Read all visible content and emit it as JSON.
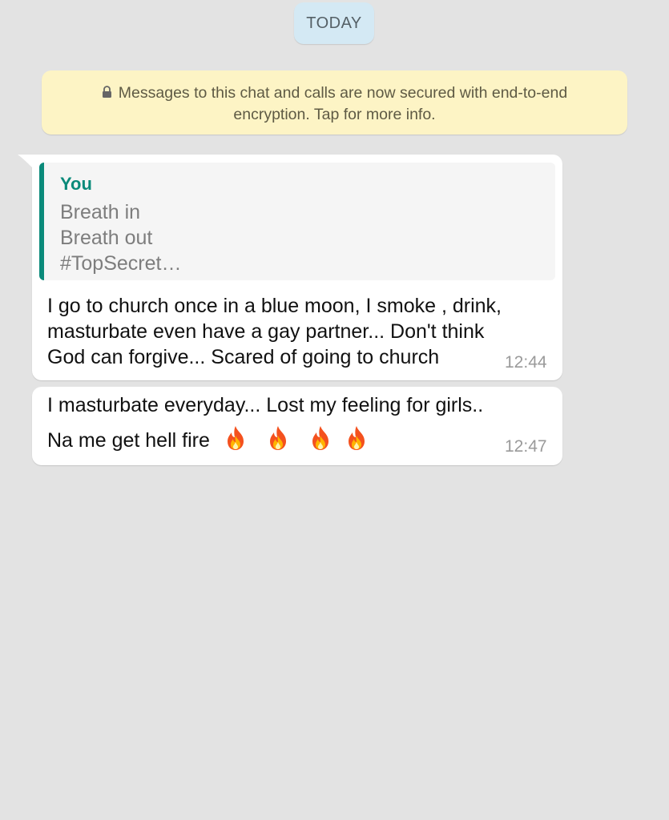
{
  "date_chip": {
    "label": "TODAY"
  },
  "encryption_notice": {
    "line1": "Messages to this chat and calls are now secured with end-to-end",
    "line2": "encryption. Tap for more info.",
    "icon": "lock-icon"
  },
  "messages": [
    {
      "quoted": {
        "author": "You",
        "lines": [
          "Breath in",
          "Breath out",
          "#TopSecret…"
        ]
      },
      "lines": [
        "I go to church once in a blue moon, I smoke , drink,",
        "masturbate even have a gay partner... Don't think",
        "God can forgive... Scared of going to church"
      ],
      "time": "12:44"
    },
    {
      "lines": [
        "I masturbate everyday... Lost my feeling for girls..",
        "Na me get hell fire"
      ],
      "emoji": [
        "fire-icon",
        "fire-icon",
        "fire-icon",
        "fire-icon"
      ],
      "time": "12:47"
    }
  ],
  "colors": {
    "background": "#e3e3e3",
    "date_chip": "#d4e9f4",
    "notice": "#fdf4c5",
    "quote_accent": "#0a8a7a",
    "bubble": "#ffffff"
  }
}
